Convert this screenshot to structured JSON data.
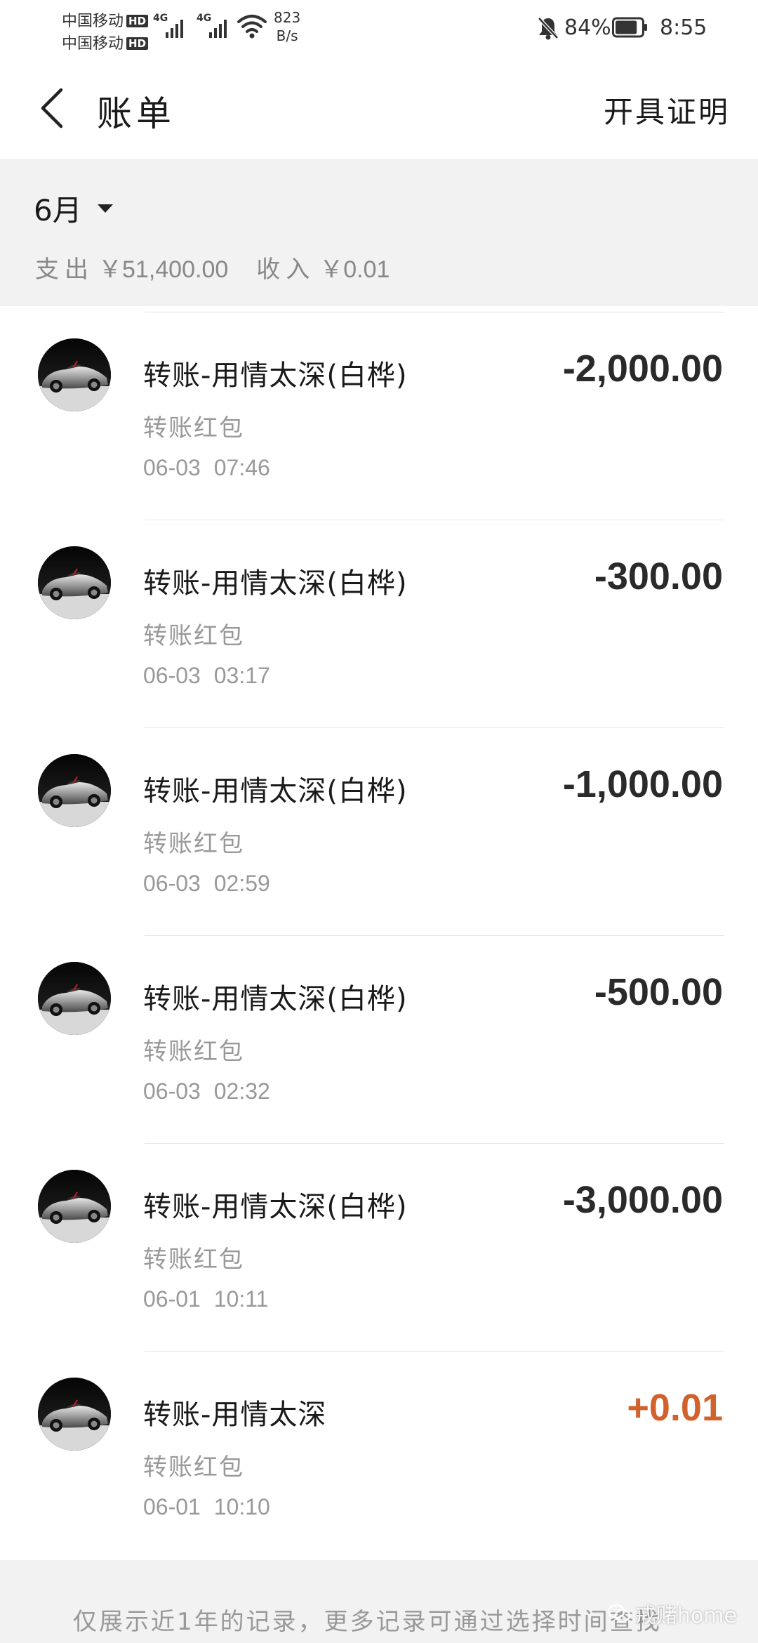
{
  "status_bar": {
    "carrier_1": "中国移动",
    "carrier_2": "中国移动",
    "hd_badge": "HD",
    "network_gen": "4G",
    "net_speed_value": "823",
    "net_speed_unit": "B/s",
    "battery_percent": "84%",
    "battery_level": 0.84,
    "time": "8:55"
  },
  "header": {
    "back_icon": "chevron-left-icon",
    "title": "账单",
    "certificate_label": "开具证明"
  },
  "summary": {
    "month": "6月",
    "expense_label": "支出",
    "expense_amount": "￥51,400.00",
    "income_label": "收入",
    "income_amount": "￥0.01"
  },
  "transactions": [
    {
      "name": "转账-用情太深(白桦)",
      "type": "转账红包",
      "time": "06-03  07:46",
      "amount": "-2,000.00",
      "direction": "expense"
    },
    {
      "name": "转账-用情太深(白桦)",
      "type": "转账红包",
      "time": "06-03  03:17",
      "amount": "-300.00",
      "direction": "expense"
    },
    {
      "name": "转账-用情太深(白桦)",
      "type": "转账红包",
      "time": "06-03  02:59",
      "amount": "-1,000.00",
      "direction": "expense"
    },
    {
      "name": "转账-用情太深(白桦)",
      "type": "转账红包",
      "time": "06-03  02:32",
      "amount": "-500.00",
      "direction": "expense"
    },
    {
      "name": "转账-用情太深(白桦)",
      "type": "转账红包",
      "time": "06-01  10:11",
      "amount": "-3,000.00",
      "direction": "expense"
    },
    {
      "name": "转账-用情太深",
      "type": "转账红包",
      "time": "06-01  10:10",
      "amount": "+0.01",
      "direction": "income"
    }
  ],
  "footer": {
    "note": "仅展示近1年的记录，更多记录可通过选择时间查找"
  },
  "watermark": {
    "text": "戒赌home",
    "icon": "wechat-icon"
  },
  "colors": {
    "income_amount": "#d2622b",
    "expense_amount": "#2a2a2a",
    "summary_background": "#f2f2f2",
    "secondary_text": "#999999"
  }
}
